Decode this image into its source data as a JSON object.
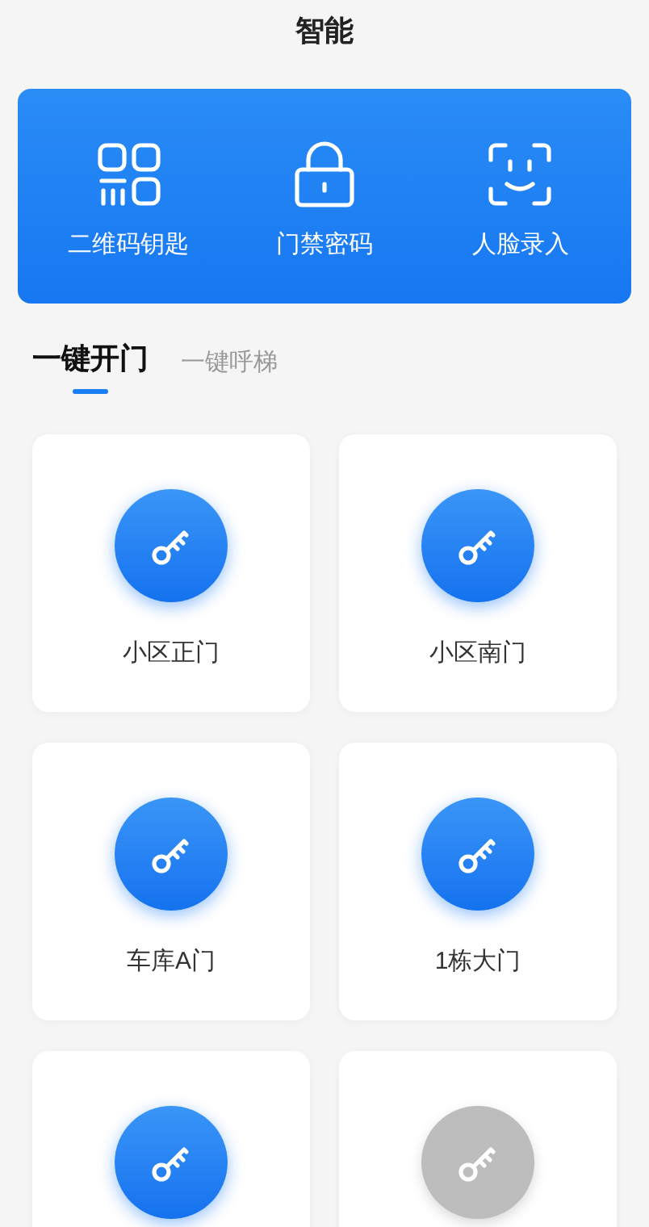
{
  "header": {
    "title": "智能"
  },
  "shortcuts": [
    {
      "kind": "qr",
      "label": "二维码钥匙"
    },
    {
      "kind": "lock",
      "label": "门禁密码"
    },
    {
      "kind": "face",
      "label": "人脸录入"
    }
  ],
  "tabs": [
    {
      "label": "一键开门",
      "selected": true
    },
    {
      "label": "一键呼梯",
      "selected": false
    }
  ],
  "doors": [
    {
      "name": "小区正门",
      "disabled": false
    },
    {
      "name": "小区南门",
      "disabled": false
    },
    {
      "name": "车库A门",
      "disabled": false
    },
    {
      "name": "1栋大门",
      "disabled": false
    },
    {
      "disabled": false
    },
    {
      "disabled": true
    }
  ]
}
